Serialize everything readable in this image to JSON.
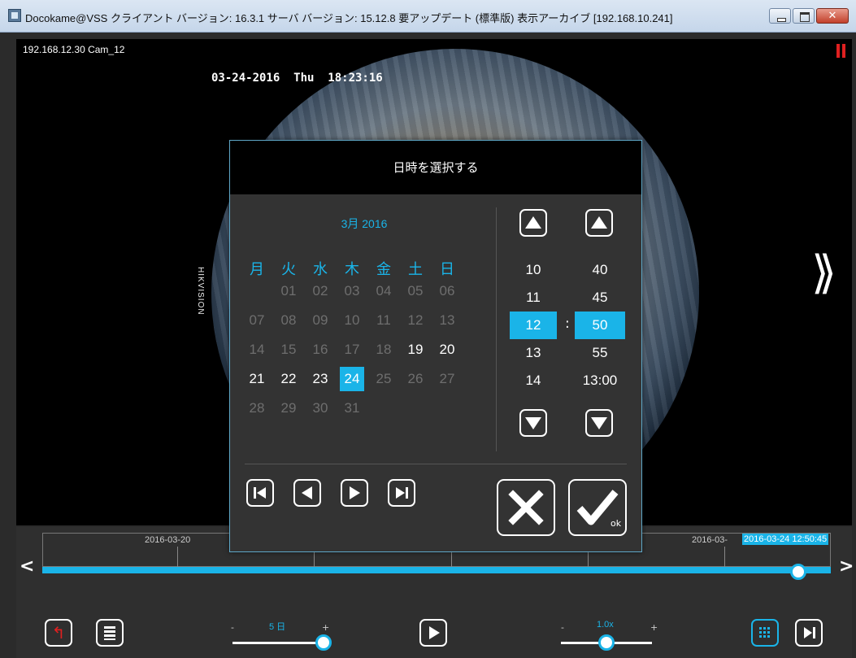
{
  "window": {
    "title": "Docokame@VSS クライアント バージョン: 16.3.1 サーバ バージョン: 15.12.8 要アップデート (標準版) 表示アーカイブ [192.168.10.241]"
  },
  "video": {
    "camera_label": "192.168.12.30 Cam_12",
    "osd_timestamp": "03-24-2016  Thu  18:23:16",
    "osd_brand": "HIKVISION"
  },
  "timeline": {
    "date_left": "2016-03-20",
    "date_right": "2016-03-",
    "cursor_time": "2016-03-24 12:50:45",
    "prev_label": "<",
    "next_label": ">"
  },
  "controls": {
    "range_minus": "-",
    "range_plus": "+",
    "range_value": "5 日",
    "speed_minus": "-",
    "speed_plus": "+",
    "speed_value": "1.0x"
  },
  "modal": {
    "title": "日時を選択する",
    "month_label": "3月 2016",
    "weekdays": [
      "月",
      "火",
      "水",
      "木",
      "金",
      "土",
      "日"
    ],
    "days": [
      [
        "",
        "01",
        "02",
        "03",
        "04",
        "05",
        "06"
      ],
      [
        "07",
        "08",
        "09",
        "10",
        "11",
        "12",
        "13"
      ],
      [
        "14",
        "15",
        "16",
        "17",
        "18",
        "19",
        "20"
      ],
      [
        "21",
        "22",
        "23",
        "24",
        "25",
        "26",
        "27"
      ],
      [
        "28",
        "29",
        "30",
        "31",
        "",
        "",
        ""
      ]
    ],
    "active_days": [
      "19",
      "20",
      "21",
      "22",
      "23",
      "24"
    ],
    "selected_day": "24",
    "hours": [
      "10",
      "11",
      "12",
      "13",
      "14"
    ],
    "selected_hour": "12",
    "minutes": [
      "40",
      "45",
      "50",
      "55",
      "13:00"
    ],
    "selected_minute": "50",
    "time_separator": ":",
    "ok_label": "ok"
  },
  "colors": {
    "accent": "#1ab4e8",
    "pause": "#e02020"
  }
}
